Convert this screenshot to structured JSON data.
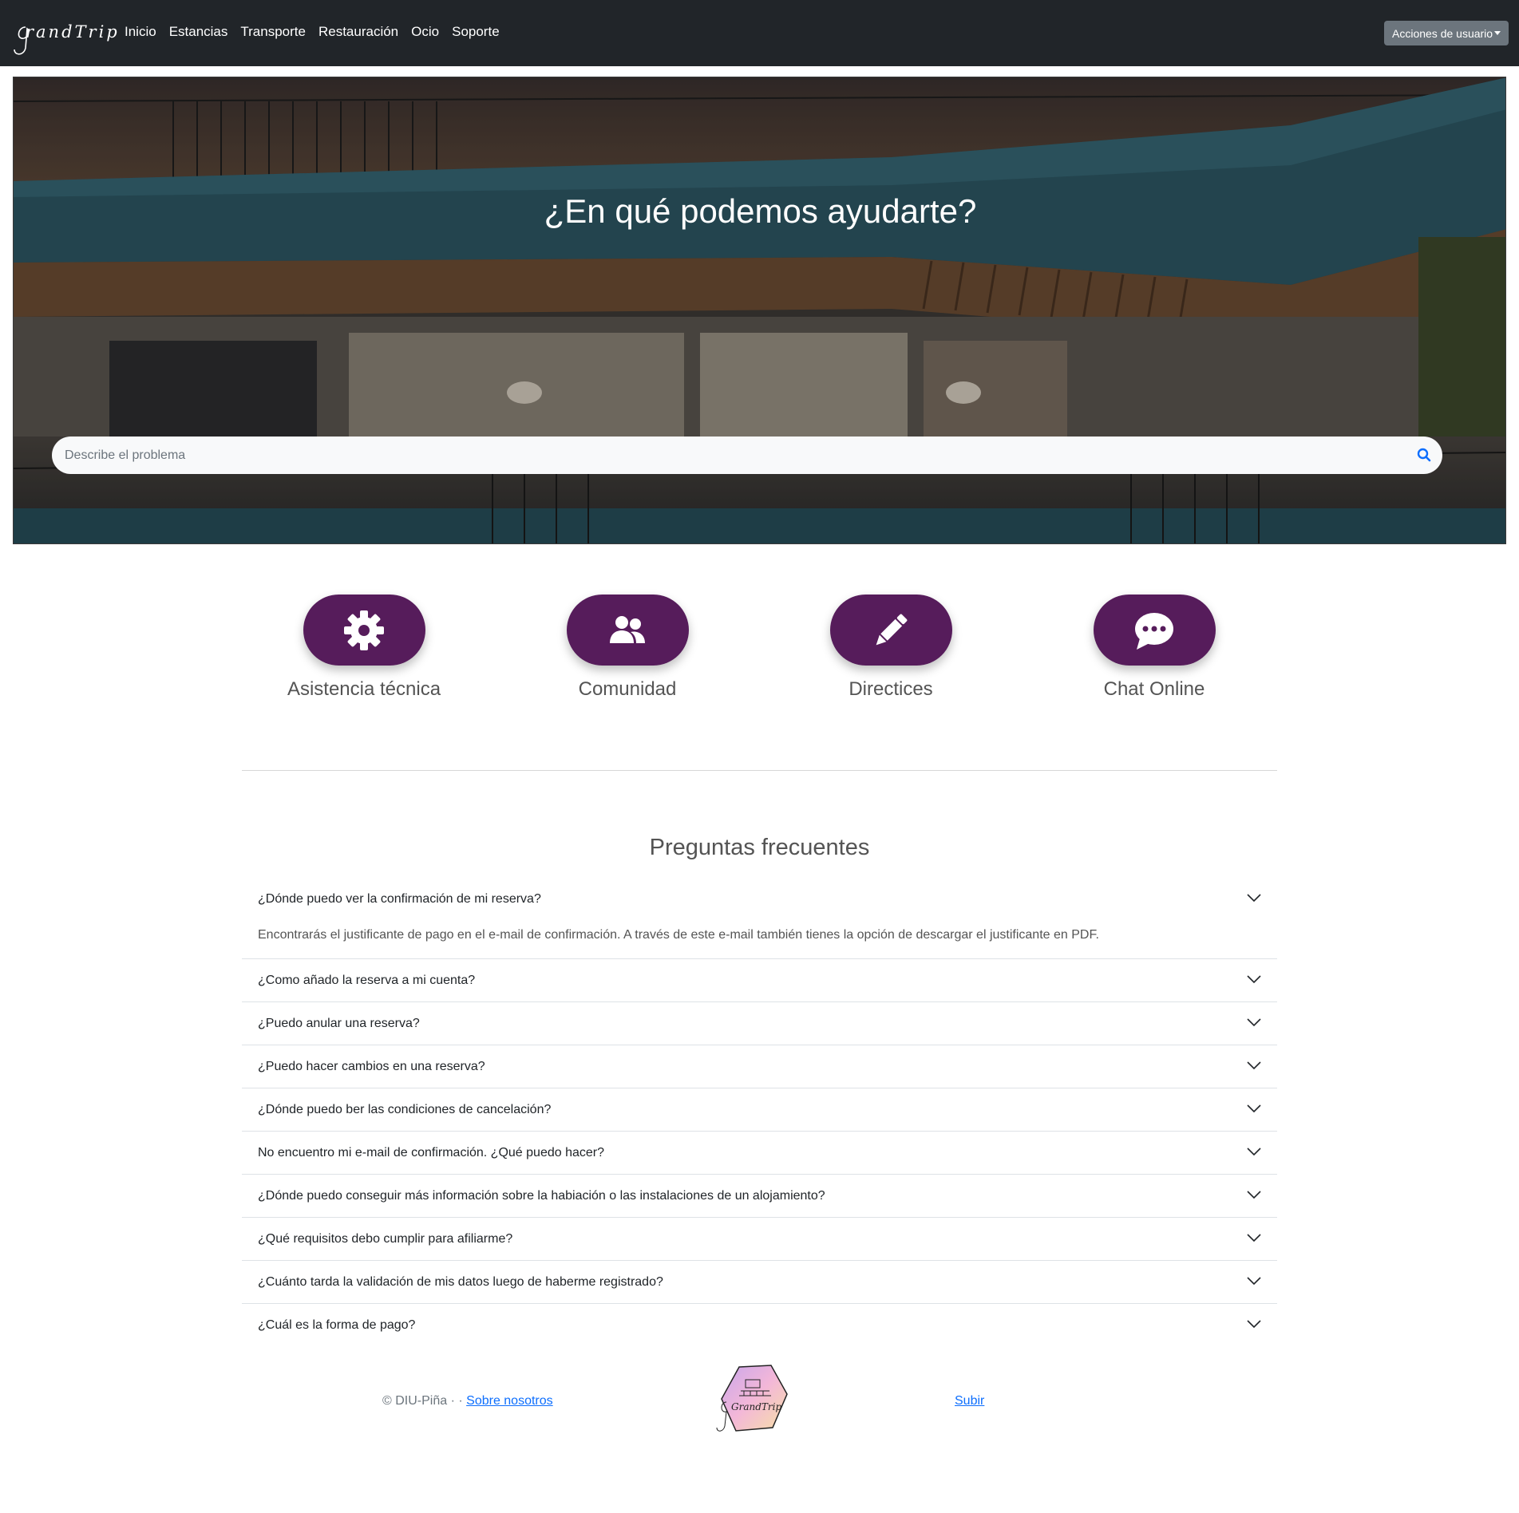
{
  "navbar": {
    "brand": "randTrip",
    "links": [
      "Inicio",
      "Estancias",
      "Transporte",
      "Restauración",
      "Ocio",
      "Soporte"
    ],
    "user_actions": "Acciones de usuario"
  },
  "hero": {
    "title": "¿En qué podemos ayudarte?",
    "search_placeholder": "Describe el problema"
  },
  "categories": [
    {
      "label": "Asistencia técnica",
      "icon": "gear-icon"
    },
    {
      "label": "Comunidad",
      "icon": "users-icon"
    },
    {
      "label": "Directices",
      "icon": "pencil-icon"
    },
    {
      "label": "Chat Online",
      "icon": "chat-icon"
    }
  ],
  "faq": {
    "title": "Preguntas frecuentes",
    "items": [
      {
        "q": "¿Dónde puedo ver la confirmación de mi reserva?",
        "a": "Encontrarás el justificante de pago en el e-mail de confirmación. A través de este e-mail también tienes la opción de descargar el justificante en PDF."
      },
      {
        "q": "¿Como añado la reserva a mi cuenta?"
      },
      {
        "q": "¿Puedo anular una reserva?"
      },
      {
        "q": "¿Puedo hacer cambios en una reserva?"
      },
      {
        "q": "¿Dónde puedo ber las condiciones de cancelación?"
      },
      {
        "q": "No encuentro mi e-mail de confirmación. ¿Qué puedo hacer?"
      },
      {
        "q": "¿Dónde puedo conseguir más información sobre la habiación o las instalaciones de un alojamiento?"
      },
      {
        "q": "¿Qué requisitos debo cumplir para afiliarme?"
      },
      {
        "q": "¿Cuánto tarda la validación de mis datos luego de haberme registrado?"
      },
      {
        "q": "¿Cuál es la forma de pago?"
      }
    ]
  },
  "footer": {
    "copyright": "© DIU-Piña · ·",
    "about": "Sobre nosotros",
    "logo_text": "GrandTrip",
    "up": "Subir"
  },
  "colors": {
    "navbar": "#212529",
    "accent": "#561c5b",
    "link": "#0d6efd"
  }
}
